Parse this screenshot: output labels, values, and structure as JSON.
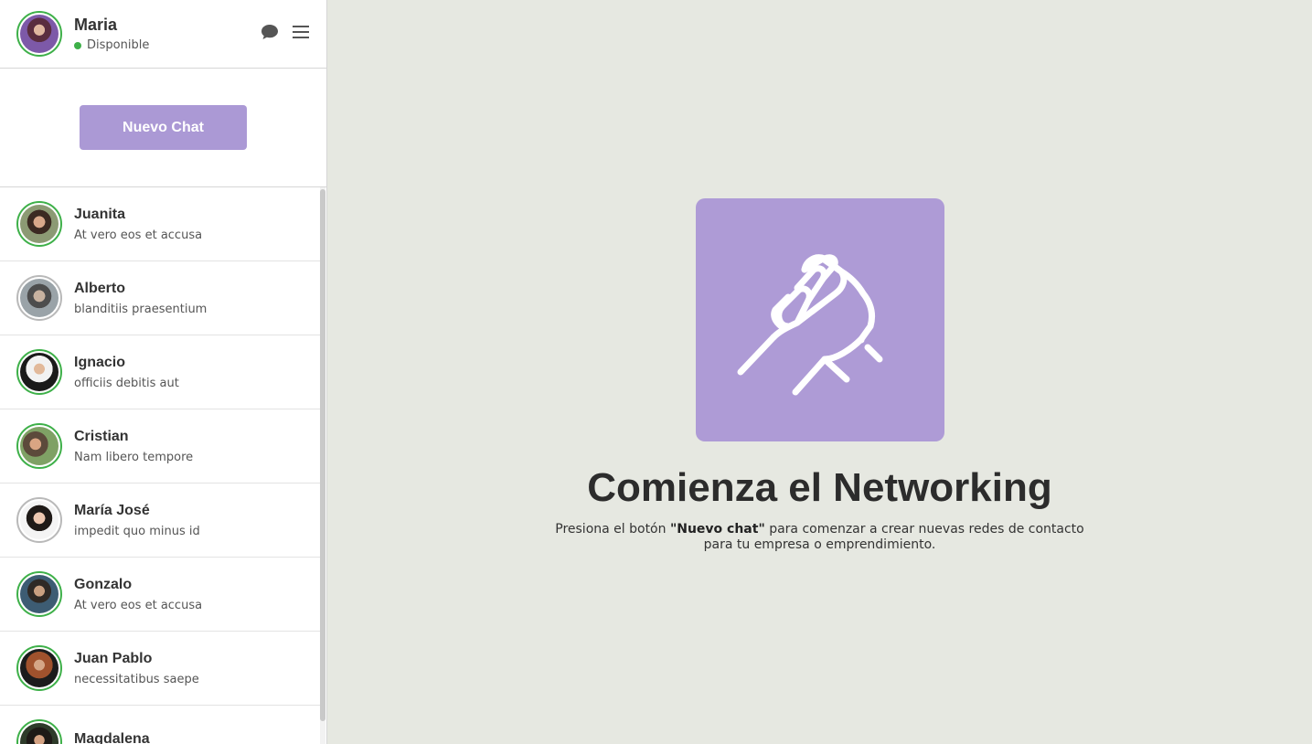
{
  "user": {
    "name": "Maria",
    "status": "Disponible",
    "status_color": "#3eb049"
  },
  "icons": {
    "chat": "chat-bubble-icon",
    "menu": "hamburger-menu-icon",
    "hero": "handshake-icon"
  },
  "new_chat_label": "Nuevo Chat",
  "chats": [
    {
      "name": "Juanita",
      "preview": "At vero eos et accusa"
    },
    {
      "name": "Alberto",
      "preview": "blanditiis praesentium"
    },
    {
      "name": "Ignacio",
      "preview": "officiis debitis aut"
    },
    {
      "name": "Cristian",
      "preview": "Nam libero tempore"
    },
    {
      "name": "María José",
      "preview": "impedit quo minus id"
    },
    {
      "name": "Gonzalo",
      "preview": "At vero eos et accusa"
    },
    {
      "name": "Juan Pablo",
      "preview": "necessitatibus saepe"
    },
    {
      "name": "Magdalena",
      "preview": ""
    }
  ],
  "main": {
    "title": "Comienza el Networking",
    "desc_before": "Presiona el botón ",
    "desc_bold": "\"Nuevo chat\"",
    "desc_after": " para comenzar a crear nuevas redes de contacto para tu empresa o emprendimiento."
  },
  "colors": {
    "accent": "#ab99d5",
    "online": "#3eb049",
    "background": "#e6e8e1"
  }
}
